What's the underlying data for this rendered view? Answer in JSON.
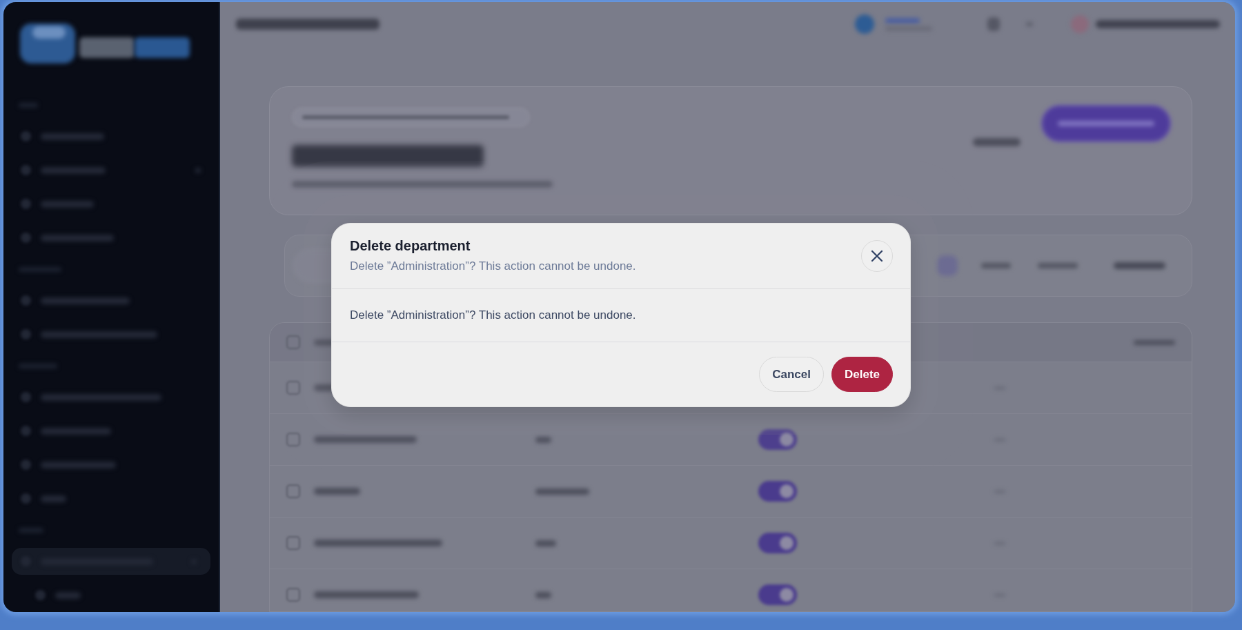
{
  "dialog": {
    "title": "Delete department",
    "subtitle": "Delete ”Administration”? This action cannot be undone.",
    "message": "Delete ”Administration”? This action cannot be undone.",
    "buttons": [
      {
        "label": "Cancel",
        "kind": "cancel"
      },
      {
        "label": "Delete",
        "kind": "danger"
      }
    ]
  }
}
